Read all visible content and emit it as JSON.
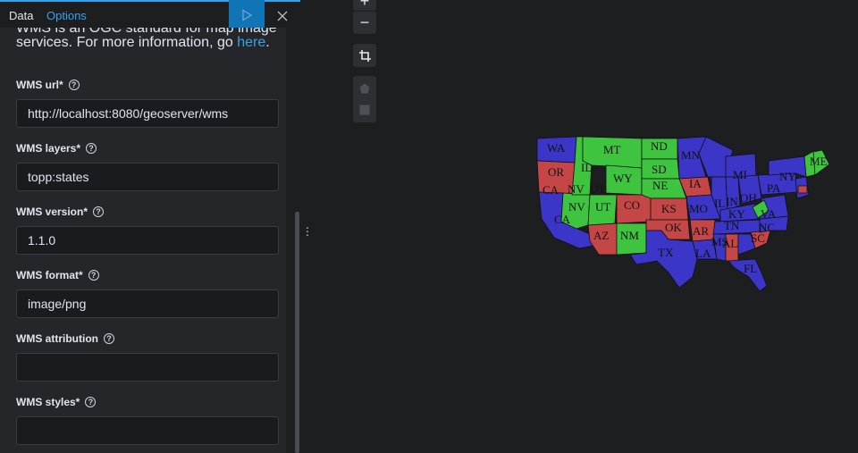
{
  "tabs": {
    "data": "Data",
    "options": "Options"
  },
  "intro": {
    "text": "WMS is an OGC standard for map image services. For more information, go ",
    "link": "here",
    "suffix": "."
  },
  "fields": {
    "url": {
      "label": "WMS url*",
      "value": "http://localhost:8080/geoserver/wms"
    },
    "layers": {
      "label": "WMS layers*",
      "value": "topp:states"
    },
    "version": {
      "label": "WMS version*",
      "value": "1.1.0"
    },
    "format": {
      "label": "WMS format*",
      "value": "image/png"
    },
    "attribution": {
      "label": "WMS attribution",
      "value": ""
    },
    "styles": {
      "label": "WMS styles*",
      "value": ""
    }
  },
  "map_controls": {
    "zoom_in": "+",
    "zoom_out": "−"
  },
  "icons": [
    "play-icon",
    "close-icon",
    "help-icon",
    "crop-icon",
    "polygon-icon",
    "square-icon",
    "drag-handle-icon"
  ],
  "state_colors": {
    "blue": "#3b35c8",
    "green": "#3ec43e",
    "red": "#c54646"
  },
  "state_labels": {
    "WA": "WA",
    "OR": "OR",
    "CA": "CA",
    "NV": "NV",
    "ID": "ID",
    "MT": "MT",
    "WY": "WY",
    "UT": "UT",
    "AZ": "AZ",
    "CO": "CO",
    "NM": "NM",
    "ND": "ND",
    "SD": "SD",
    "NE": "NE",
    "KS": "KS",
    "OK": "OK",
    "TX": "TX",
    "MN": "MN",
    "IA": "IA",
    "MO": "MO",
    "AR": "AR",
    "LA": "LA",
    "MI": "MI",
    "IL": "IL",
    "IN": "IN",
    "OH": "OH",
    "KY": "KY",
    "TN": "TN",
    "MS": "MS",
    "AL": "AL",
    "FL": "FL",
    "SC": "SC",
    "NC": "NC",
    "VA": "VA",
    "PA": "PA",
    "NY": "NY",
    "ME": "ME"
  }
}
